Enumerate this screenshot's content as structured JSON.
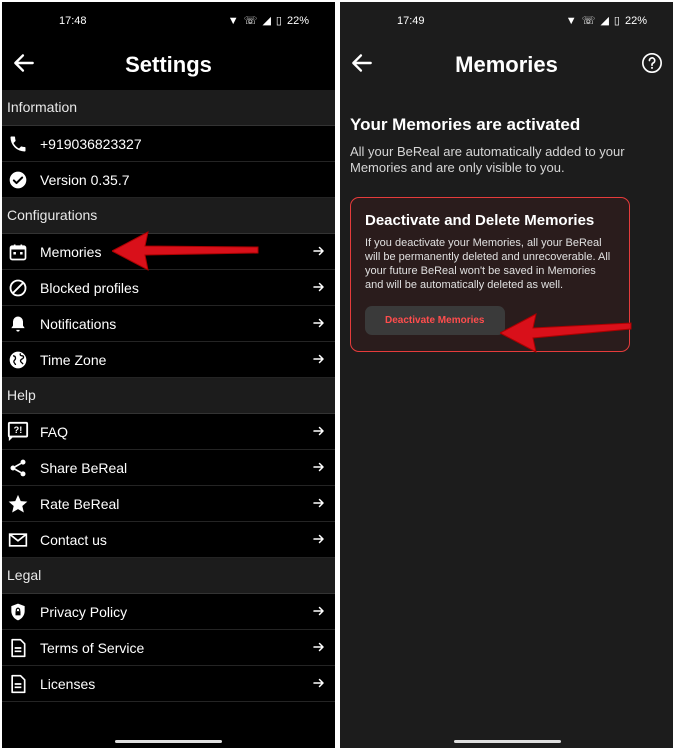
{
  "left": {
    "status": {
      "time": "17:48",
      "battery": "22%"
    },
    "title": "Settings",
    "sections": [
      {
        "label": "Information",
        "items": [
          {
            "label": "+919036823327",
            "icon": "phone-icon",
            "chevron": false
          },
          {
            "label": "Version 0.35.7",
            "icon": "check-circle-icon",
            "chevron": false
          }
        ]
      },
      {
        "label": "Configurations",
        "items": [
          {
            "label": "Memories",
            "icon": "calendar-icon",
            "chevron": true
          },
          {
            "label": "Blocked profiles",
            "icon": "block-icon",
            "chevron": true
          },
          {
            "label": "Notifications",
            "icon": "bell-icon",
            "chevron": true
          },
          {
            "label": "Time Zone",
            "icon": "globe-icon",
            "chevron": true
          }
        ]
      },
      {
        "label": "Help",
        "items": [
          {
            "label": "FAQ",
            "icon": "faq-icon",
            "chevron": true
          },
          {
            "label": "Share BeReal",
            "icon": "share-icon",
            "chevron": true
          },
          {
            "label": "Rate BeReal",
            "icon": "star-icon",
            "chevron": true
          },
          {
            "label": "Contact us",
            "icon": "mail-icon",
            "chevron": true
          }
        ]
      },
      {
        "label": "Legal",
        "items": [
          {
            "label": "Privacy Policy",
            "icon": "shield-lock-icon",
            "chevron": true
          },
          {
            "label": "Terms of Service",
            "icon": "document-icon",
            "chevron": true
          },
          {
            "label": "Licenses",
            "icon": "document-icon",
            "chevron": true
          }
        ]
      }
    ]
  },
  "right": {
    "status": {
      "time": "17:49",
      "battery": "22%"
    },
    "title": "Memories",
    "heading": "Your Memories are activated",
    "description": "All your BeReal are automatically added to your Memories and are only visible to you.",
    "card": {
      "title": "Deactivate and Delete Memories",
      "text": "If you deactivate your Memories, all your BeReal will be permanently deleted and unrecoverable. All your future BeReal won't be saved in Memories and will be automatically deleted as well.",
      "button": "Deactivate Memories"
    }
  },
  "colors": {
    "accent_red": "#e53b3b",
    "arrow_red": "#d9101a"
  }
}
